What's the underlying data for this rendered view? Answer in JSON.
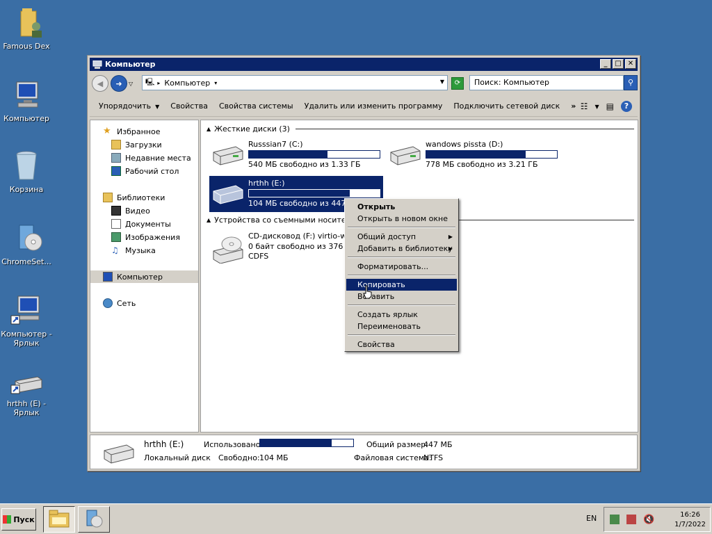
{
  "desktop": {
    "icons": [
      {
        "label": "Famous Dex"
      },
      {
        "label": "Компьютер"
      },
      {
        "label": "Корзина"
      },
      {
        "label": "ChromeSet..."
      },
      {
        "label": "Компьютер - Ярлык"
      },
      {
        "label": "hrthh (E) - Ярлык"
      }
    ]
  },
  "window": {
    "title": "Компьютер",
    "address": "Компьютер",
    "search_placeholder": "Поиск: Компьютер",
    "toolbar": {
      "organize": "Упорядочить",
      "properties": "Свойства",
      "system_properties": "Свойства системы",
      "uninstall": "Удалить или изменить программу",
      "map_drive": "Подключить сетевой диск",
      "more": "»"
    },
    "nav": {
      "favorites": "Избранное",
      "downloads": "Загрузки",
      "recent": "Недавние места",
      "desktop": "Рабочий стол",
      "libraries": "Библиотеки",
      "video": "Видео",
      "documents": "Документы",
      "images": "Изображения",
      "music": "Музыка",
      "computer": "Компьютер",
      "network": "Сеть"
    },
    "groups": {
      "hard_disks": "Жесткие диски (3)",
      "removable": "Устройства со съемными носителями (1)"
    },
    "drives": [
      {
        "name": "Russsian7  (C:)",
        "info": "540 МБ свободно из 1.33 ГБ",
        "used_fraction": 0.6
      },
      {
        "name": "wandows pissta  (D:)",
        "info": "778 МБ свободно из 3.21 ГБ",
        "used_fraction": 0.76
      },
      {
        "name": "hrthh (E:)",
        "info": "104 МБ свободно из 447 МБ",
        "used_fraction": 0.77
      }
    ],
    "cdrom": {
      "name": "CD-дисковод (F:) virtio-win",
      "info": "0 байт свободно из 376 МБ",
      "fs": "CDFS"
    },
    "details": {
      "name": "hrthh (E:)",
      "type": "Локальный диск",
      "used_label": "Использовано:",
      "free_label": "Свободно:",
      "free_value": "104 МБ",
      "total_label": "Общий размер:",
      "total_value": "447 МБ",
      "fs_label": "Файловая система:",
      "fs_value": "NTFS",
      "used_fraction": 0.77
    }
  },
  "context_menu": {
    "open": "Открыть",
    "open_new_window": "Открыть в новом окне",
    "share": "Общий доступ",
    "add_library": "Добавить в библиотеку",
    "format": "Форматировать...",
    "copy": "Копировать",
    "paste": "Вставить",
    "create_shortcut": "Создать ярлык",
    "rename": "Переименовать",
    "properties": "Свойства"
  },
  "taskbar": {
    "start": "Пуск",
    "lang": "EN",
    "time": "16:26",
    "date": "1/7/2022"
  }
}
